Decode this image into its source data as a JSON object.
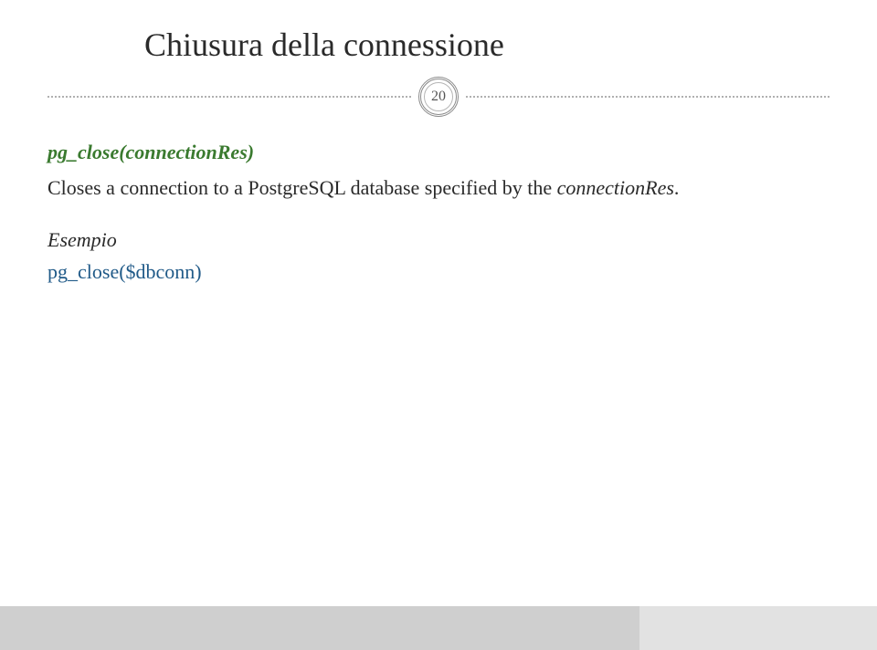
{
  "title": "Chiusura della connessione",
  "page_number": "20",
  "function_signature": "pg_close(connectionRes)",
  "description_prefix": "Closes a connection to a PostgreSQL database specified by the ",
  "description_param": "connectionRes",
  "description_suffix": ".",
  "example_label": "Esempio",
  "example_code": "pg_close($dbconn)"
}
